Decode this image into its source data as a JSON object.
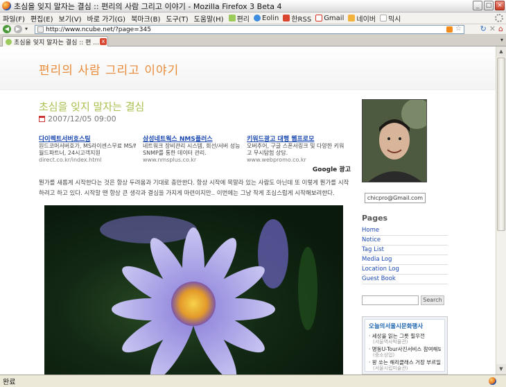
{
  "window": {
    "title": "초심을 잊지 말자는 결심 :: 편리의 사람 그리고 이야기 - Mozilla Firefox 3 Beta 4",
    "minimize": "_",
    "maximize": "□",
    "close": "×"
  },
  "menu": {
    "items": [
      "파일(F)",
      "편집(E)",
      "보기(V)",
      "바로 가기(G)",
      "북마크(B)",
      "도구(T)",
      "도움말(H)"
    ],
    "bookmarks": [
      {
        "label": "편리",
        "color": "#9acb5c"
      },
      {
        "label": "Eolin",
        "color": "#3e8de0"
      },
      {
        "label": "한RSS",
        "color": "#d9452e"
      },
      {
        "label": "Gmail",
        "color": "#d93025"
      },
      {
        "label": "네이버",
        "color": "#f2b33d"
      },
      {
        "label": "믹시",
        "color": "#dddddd"
      }
    ]
  },
  "nav": {
    "back": "◀",
    "forward": "▶",
    "dropdown": "▾",
    "url": "http://www.ncube.net/?page=345",
    "star": "☆",
    "reload": "↻",
    "stop": "✕",
    "home": "⌂"
  },
  "tab": {
    "label": "초심을 잊지 말자는 결심 :: 편 ...",
    "close": "x",
    "list": "▾"
  },
  "site": {
    "title": "편리의 사람 그리고 이야기"
  },
  "post": {
    "title": "초심을 잊지 말자는 결심",
    "date": "2007/12/05 09:00",
    "body": "뭔가를 새롭게 시작한다는 것은 항상 두려움과 기대로 충만한다. 항상 시작에 목말라 있는 사람도 아닌데 또 이렇게 뭔가를 시작하려고 하고 있다. 시작할 땐 항상 큰 생각과 결심을 가지게 마련이지만.. 이번에는 그냥 작게 조심스럽게 시작해보려한다."
  },
  "ads": {
    "google_label": "Google 광고",
    "items": [
      {
        "title": "다이렉트서버호스팅",
        "desc1": "원드코머서버호가, MS라이센스무료 MS/Mysql",
        "desc2": "월드파트너, 24시고객지원",
        "url": "direct.co.kr/index.html"
      },
      {
        "title": "삼성네트웍스 NMS플러스",
        "desc1": "네트워크 장비관리 시스템, 회선/서버 성능분석,",
        "desc2": "SNMP를 통한 데이터 관리.",
        "url": "www.nmsplus.co.kr"
      },
      {
        "title": "키워드광고 대행 웹프로모",
        "desc1": "오버추어, 구글 스폰서링크 및 다양한 키워드탕",
        "desc2": "고 무시탐험 상담.",
        "url": "www.webpromo.co.kr"
      }
    ]
  },
  "sidebar": {
    "email": "chicpro@Gmail.com",
    "pages_heading": "Pages",
    "pages": [
      "Home",
      "Notice",
      "Tag List",
      "Media Log",
      "Location Log",
      "Guest Book"
    ],
    "search_button": "Search",
    "widget": {
      "title": "오늘의서울시문화행사",
      "items": [
        {
          "text": "· 세상을 읽는 그릇 필우전",
          "sub": "(서울역사박물관)"
        },
        {
          "text": "· 명동U-Tour사진서비스 참여해보세요!",
          "sub": "(중소상업)"
        },
        {
          "text": "· 왕 쏘는 해리클래스 거장 부르일 류",
          "sub": "(서울시립미술관)"
        }
      ]
    }
  },
  "status": {
    "text": "완료"
  }
}
